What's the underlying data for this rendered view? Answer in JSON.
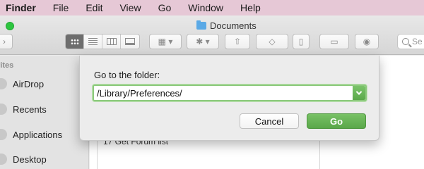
{
  "menubar": {
    "items": [
      "Finder",
      "File",
      "Edit",
      "View",
      "Go",
      "Window",
      "Help"
    ]
  },
  "window": {
    "title": "Documents",
    "search_placeholder": "Se"
  },
  "sidebar": {
    "header": "rites",
    "items": [
      {
        "label": "AirDrop"
      },
      {
        "label": "Recents"
      },
      {
        "label": "Applications"
      },
      {
        "label": "Desktop"
      }
    ]
  },
  "content": {
    "partial_text": "17 Get Forum list"
  },
  "dialog": {
    "prompt": "Go to the folder:",
    "path_value": "/Library/Preferences/",
    "cancel_label": "Cancel",
    "go_label": "Go"
  },
  "colors": {
    "accent_green": "#5aa74a",
    "focus_ring": "#8cc97c",
    "menubar_bg": "#e6c8d6"
  }
}
